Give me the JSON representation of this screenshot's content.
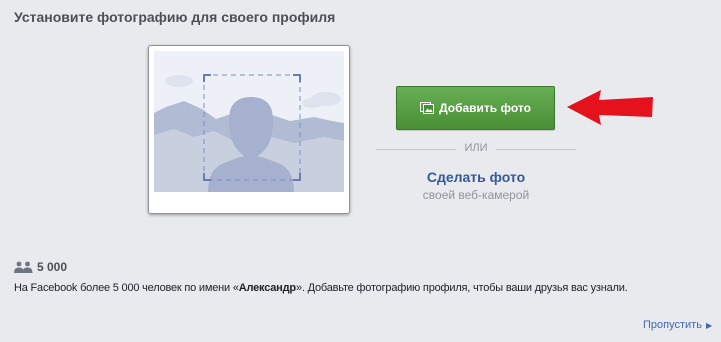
{
  "header": {
    "title": "Установите фотографию для своего профиля"
  },
  "upload": {
    "add_photo_label": "Добавить фото",
    "or_label": "ИЛИ",
    "webcam_title": "Сделать фото",
    "webcam_subtitle": "своей веб-камерой"
  },
  "stats": {
    "count": "5 000",
    "desc_prefix": "На Facebook более 5 000 человек по имени «",
    "desc_name": "Александр",
    "desc_suffix": "». Добавьте фотографию профиля, чтобы ваши друзья вас узнали."
  },
  "footer": {
    "skip_label": "Пропустить"
  },
  "icons": {
    "add_photo": "photo-icon",
    "annotation": "red-arrow-icon",
    "people": "people-icon",
    "skip_caret": "caret-right-icon"
  },
  "colors": {
    "page_bg": "#e9eaed",
    "button_green": "#4a8f36",
    "link_blue": "#365899",
    "arrow_red": "#e5121e"
  }
}
